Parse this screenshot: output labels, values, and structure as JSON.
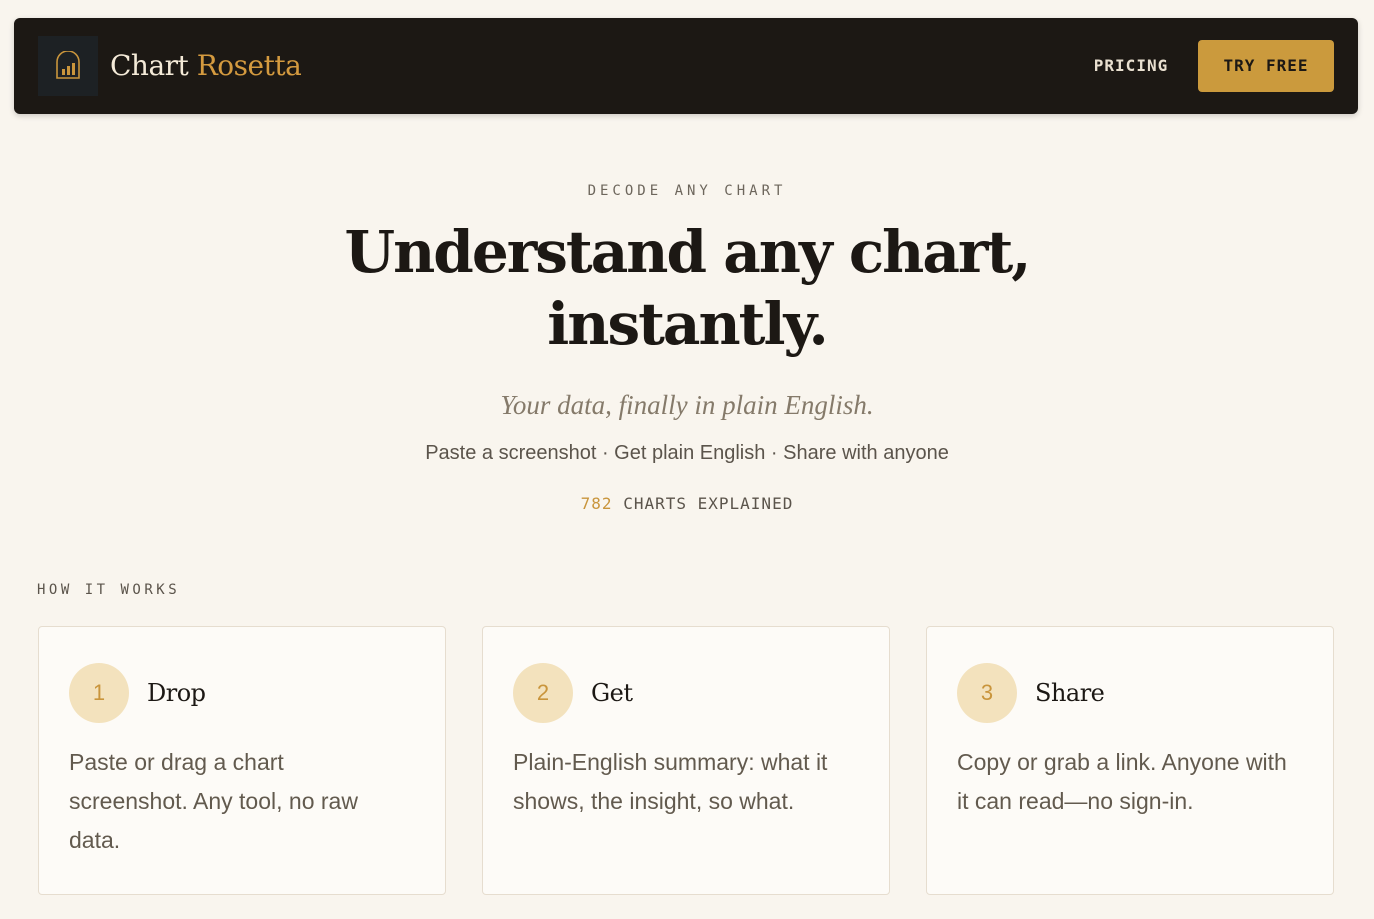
{
  "nav": {
    "brand_primary": "Chart",
    "brand_accent": "Rosetta",
    "logo_icon": "bar-chart-icon",
    "links": [
      {
        "label": "PRICING"
      }
    ],
    "cta_label": "TRY FREE"
  },
  "hero": {
    "eyebrow": "DECODE ANY CHART",
    "title_line1": "Understand any chart,",
    "title_line2": "instantly.",
    "subtitle": "Your data, finally in plain English.",
    "steps_line": "Paste a screenshot · Get plain English · Share with anyone",
    "counter_value": "782",
    "counter_label": "CHARTS EXPLAINED"
  },
  "how_it_works": {
    "label": "HOW IT WORKS",
    "steps": [
      {
        "number": "1",
        "title": "Drop",
        "description": "Paste or drag a chart screenshot. Any tool, no raw data."
      },
      {
        "number": "2",
        "title": "Get",
        "description": "Plain-English summary: what it shows, the insight, so what."
      },
      {
        "number": "3",
        "title": "Share",
        "description": "Copy or grab a link. Anyone with it can read—no sign-in."
      }
    ]
  },
  "colors": {
    "background": "#f9f5ee",
    "nav_background": "#1c1814",
    "accent": "#cb9a3d",
    "step_badge": "#f3e2bd"
  }
}
